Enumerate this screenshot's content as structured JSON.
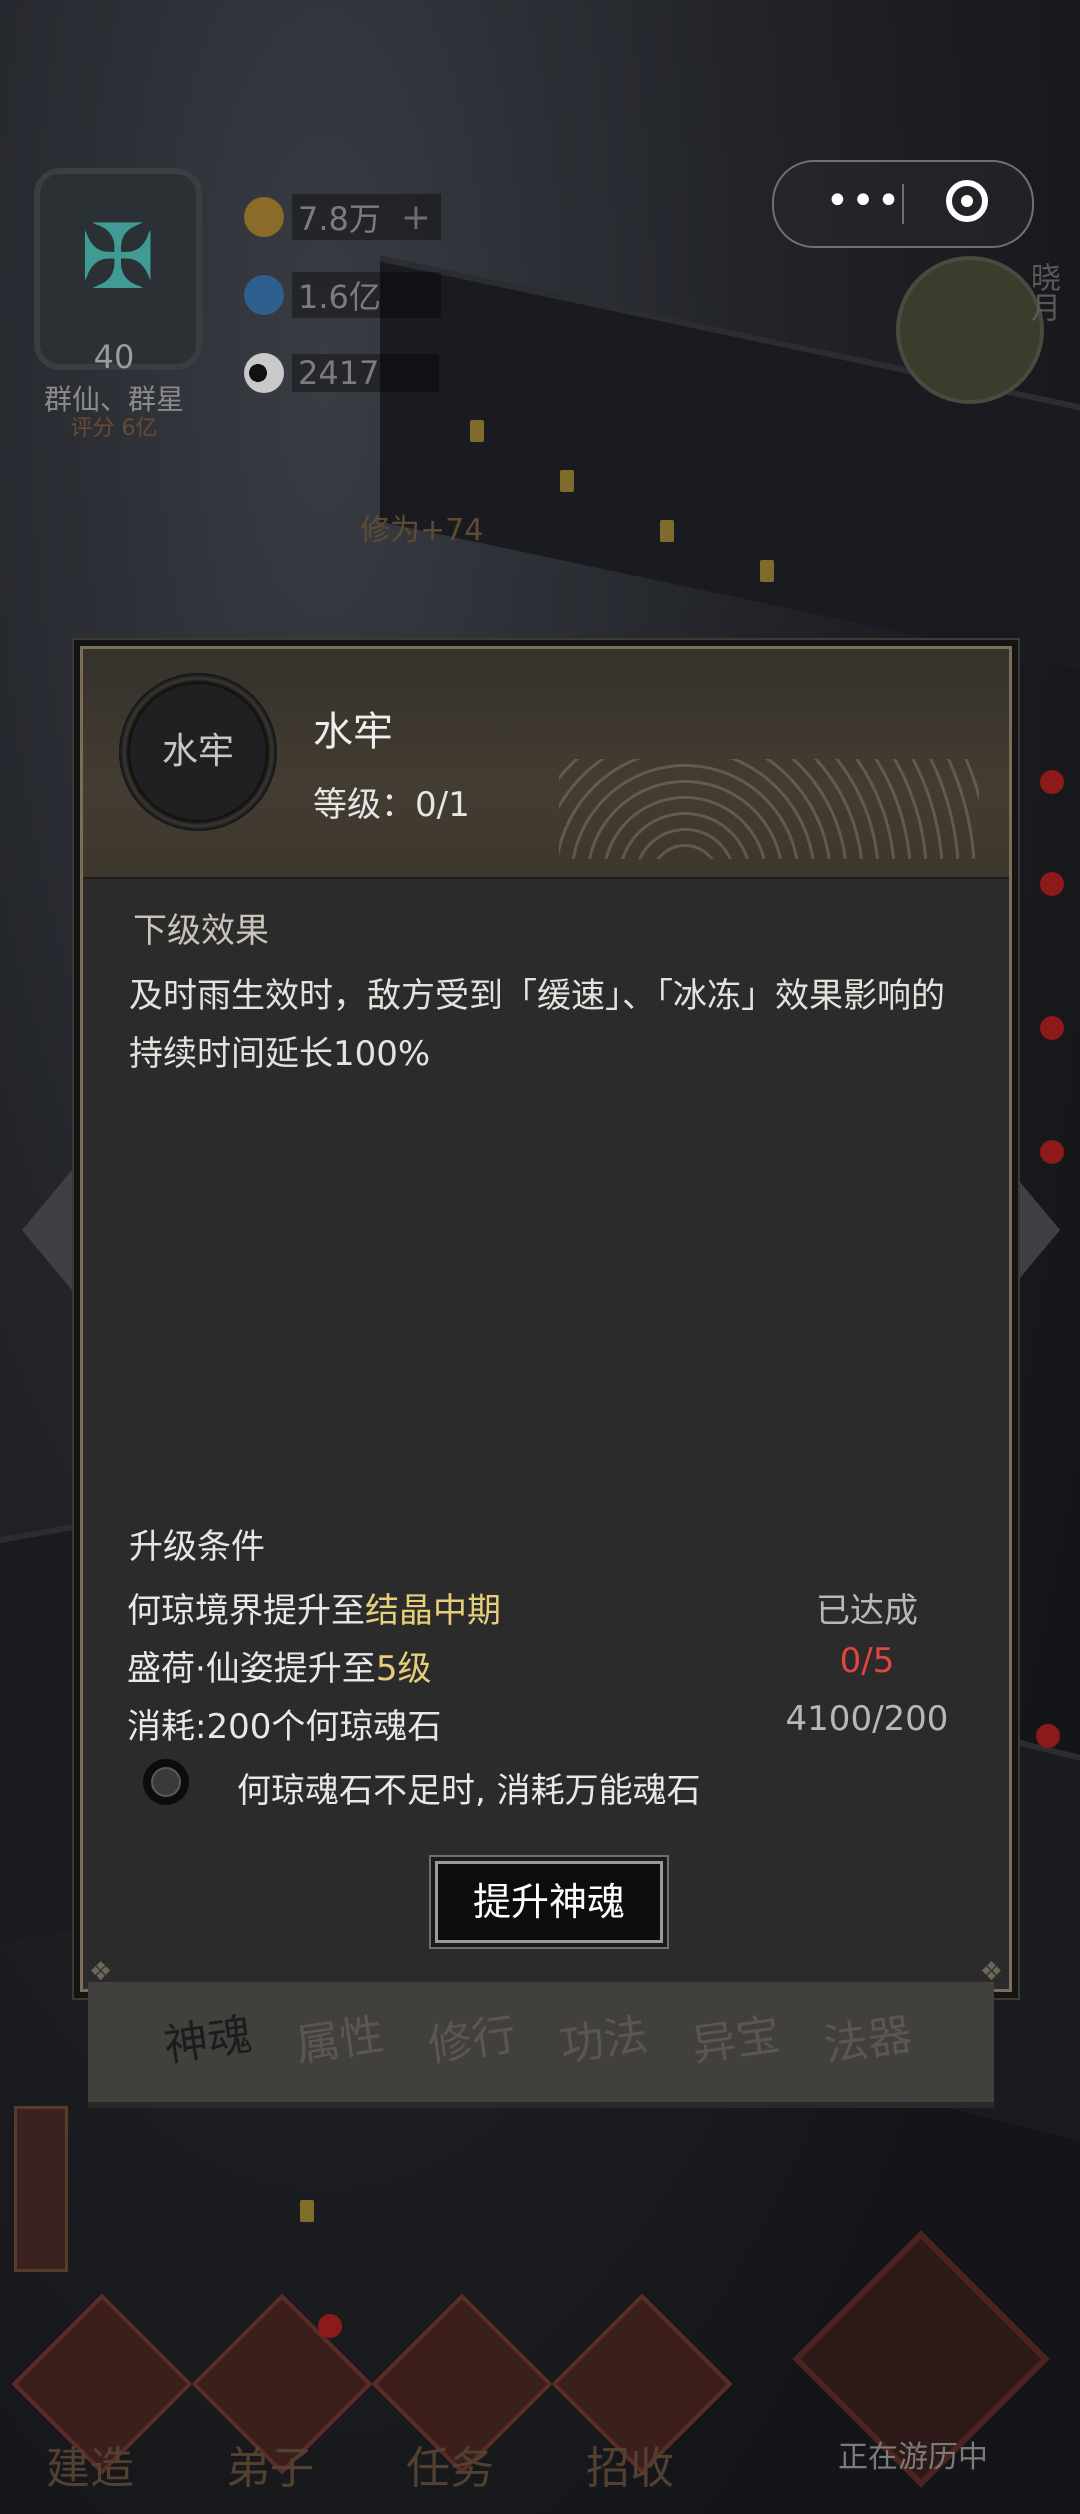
{
  "hud": {
    "profile": {
      "level": "40",
      "name": "群仙、群星",
      "score": "评分 6亿"
    },
    "resources": [
      {
        "value": "7.8万",
        "has_plus": true,
        "color": "#8b6a2a"
      },
      {
        "value": "1.6亿",
        "has_plus": false,
        "color": "#2f5f8e"
      },
      {
        "value": "2417",
        "has_plus": false,
        "color": "#c9c9c9"
      }
    ],
    "plus_label": "+",
    "exp_popup": "修为+74",
    "clock_label": "晓月"
  },
  "capsule": {
    "more_label": "•••"
  },
  "modal": {
    "skill": {
      "icon_text": "水牢",
      "name": "水牢",
      "level": "等级：0/1"
    },
    "next_effect_title": "下级效果",
    "next_effect_text": "及时雨生效时，敌方受到「缓速」、「冰冻」效果影响的持续时间延长100%",
    "upgrade_title": "升级条件",
    "conditions": [
      {
        "prefix": "何琼境界提升至",
        "highlight": "结晶中期",
        "suffix": "",
        "status": "已达成",
        "status_color": "#b8b8b8"
      },
      {
        "prefix": "盛荷·仙姿提升至",
        "highlight": "5级",
        "suffix": "",
        "status": "0/5",
        "status_color": "#e0453f"
      },
      {
        "prefix": "消耗:200个何琼魂石",
        "highlight": "",
        "suffix": "",
        "status": "4100/200",
        "status_color": "#b8b8b8"
      }
    ],
    "option_label": "何琼魂石不足时, 消耗万能魂石",
    "upgrade_button": "提升神魂"
  },
  "tabs": [
    {
      "label": "神魂",
      "active": true
    },
    {
      "label": "属性",
      "active": false
    },
    {
      "label": "修行",
      "active": false
    },
    {
      "label": "功法",
      "active": false
    },
    {
      "label": "异宝",
      "active": false
    },
    {
      "label": "法器",
      "active": false
    }
  ],
  "bottom_nav": [
    {
      "label": "建造"
    },
    {
      "label": "弟子"
    },
    {
      "label": "任务"
    },
    {
      "label": "招收"
    }
  ],
  "travel_status": "正在游历中",
  "colors": {
    "accent_gold": "#e7cf7a",
    "warn_red": "#e0453f",
    "modal_bg": "#2b2b2c"
  }
}
